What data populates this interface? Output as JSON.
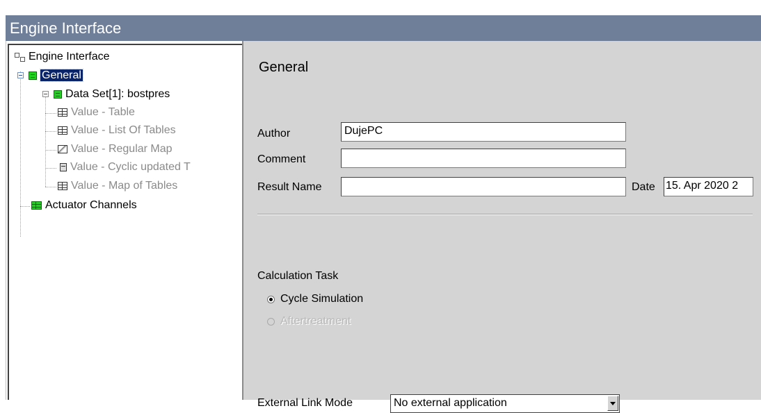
{
  "window": {
    "title": "Engine Interface"
  },
  "tree": {
    "root": "Engine Interface",
    "general": "General",
    "dataset": "Data Set[1]: bostpres",
    "values": [
      "Value - Table",
      "Value - List Of Tables",
      "Value - Regular Map",
      "Value - Cyclic updated T",
      "Value - Map of Tables"
    ],
    "actuator": "Actuator Channels"
  },
  "form": {
    "title": "General",
    "author_label": "Author",
    "author_value": "DujePC",
    "comment_label": "Comment",
    "comment_value": "",
    "result_label": "Result Name",
    "result_value": "",
    "date_label": "Date",
    "date_value": "15. Apr 2020 2",
    "calc_label": "Calculation Task",
    "calc_options": [
      "Cycle Simulation",
      "Aftertreatment"
    ],
    "ext_label": "External Link Mode",
    "ext_value": "No external application"
  }
}
